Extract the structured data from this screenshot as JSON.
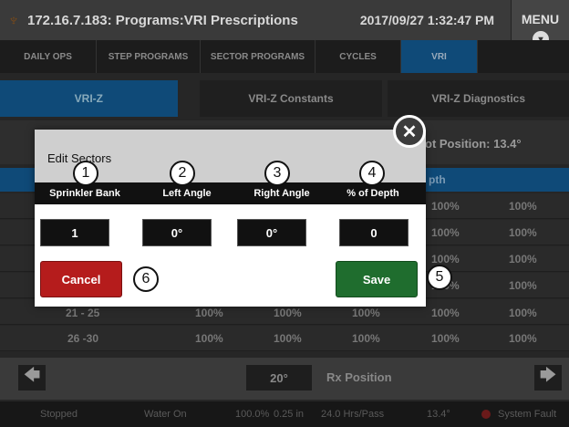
{
  "titlebar": {
    "logo_glyph": "♆",
    "title": "172.16.7.183: Programs:VRI Prescriptions",
    "datetime": "2017/09/27 1:32:47 PM",
    "menu_label": "MENU",
    "menu_chevron": "▾"
  },
  "nav_tabs": [
    "DAILY OPS",
    "STEP PROGRAMS",
    "SECTOR PROGRAMS",
    "CYCLES",
    "VRI"
  ],
  "sub_tabs": [
    "VRI-Z",
    "VRI-Z Constants",
    "VRI-Z Diagnostics"
  ],
  "info": {
    "pivot_position": "ot Position: 13.4°"
  },
  "grid": {
    "header_depth": "pth",
    "rows": [
      {
        "range": "",
        "left": "",
        "right": "",
        "depth": "",
        "c5": "100%",
        "c6": "100%"
      },
      {
        "range": "",
        "left": "",
        "right": "",
        "depth": "",
        "c5": "100%",
        "c6": "100%"
      },
      {
        "range": "",
        "left": "",
        "right": "",
        "depth": "",
        "c5": "100%",
        "c6": "100%"
      },
      {
        "range": "",
        "left": "",
        "right": "",
        "depth": "",
        "c5": "100%",
        "c6": "100%"
      },
      {
        "range": "21 - 25",
        "left": "100%",
        "right": "100%",
        "depth": "100%",
        "c5": "100%",
        "c6": "100%"
      },
      {
        "range": "26 -30",
        "left": "100%",
        "right": "100%",
        "depth": "100%",
        "c5": "100%",
        "c6": "100%"
      }
    ]
  },
  "bottom": {
    "left_arrow": "🡄",
    "right_arrow": "🡆",
    "rx_value": "20°",
    "rx_label": "Rx Position"
  },
  "status_bar": {
    "state": "Stopped",
    "water": "Water On",
    "percent": "100.0%",
    "depth": "0.25 in",
    "hrs": "24.0 Hrs/Pass",
    "angle": "13.4°",
    "fault": "System Fault"
  },
  "modal": {
    "title": "Edit Sectors",
    "columns": [
      "Sprinkler Bank",
      "Left Angle",
      "Right Angle",
      "% of Depth"
    ],
    "values": [
      "1",
      "0°",
      "0°",
      "0"
    ],
    "cancel_label": "Cancel",
    "save_label": "Save",
    "close_glyph": "✕"
  },
  "callouts": [
    "1",
    "2",
    "3",
    "4",
    "5",
    "6"
  ]
}
